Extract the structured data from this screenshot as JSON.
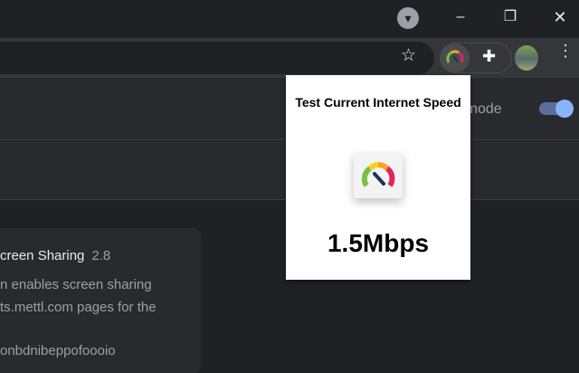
{
  "window": {
    "minimize": "–",
    "restore": "❐",
    "close": "✕",
    "profile_dropdown": "▾"
  },
  "toolbar": {
    "bookmark_star": "☆",
    "extensions_puzzle": "✚",
    "menu": "⋮"
  },
  "page": {
    "developer_mode_label": "er mode",
    "developer_mode_on": true
  },
  "extension_card": {
    "name": "creen Sharing",
    "version": "2.8",
    "description_lines": [
      "n enables screen sharing",
      "ts.mettl.com pages for the"
    ],
    "id": "onbdnibeppofoooio"
  },
  "popup": {
    "title": "Test Current Internet Speed",
    "speed": "1.5Mbps"
  },
  "colors": {
    "accent": "#8ab4f8",
    "bg": "#202124"
  }
}
